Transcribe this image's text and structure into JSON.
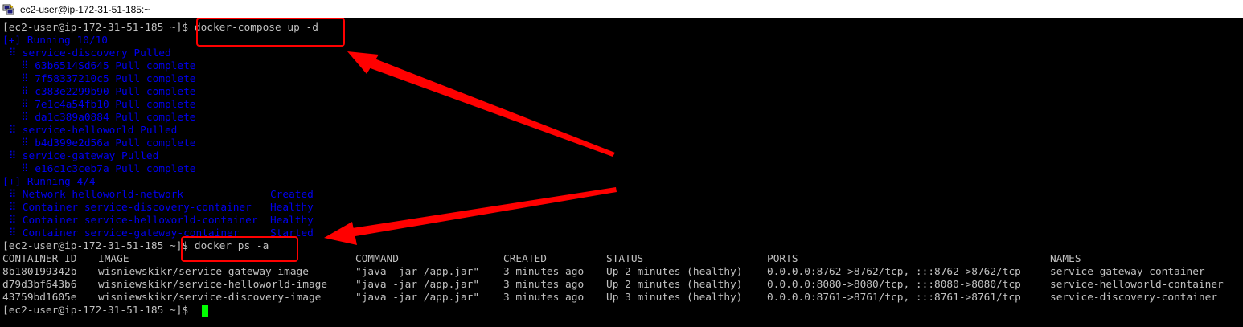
{
  "window": {
    "title": "ec2-user@ip-172-31-51-185:~"
  },
  "colors": {
    "prompt_text": "#c0c0c0",
    "compose_output": "#0000ee",
    "annotation": "#ff0000",
    "cursor": "#00ff00"
  },
  "prompt": "[ec2-user@ip-172-31-51-185 ~]$",
  "commands": {
    "first": "docker-compose up -d",
    "second": "docker ps -a"
  },
  "compose_output": [
    "[+] Running 10/10",
    " ⠿ service-discovery Pulled",
    "   ⠿ 63b6514Sd645 Pull complete",
    "   ⠿ 7f58337210c5 Pull complete",
    "   ⠿ c383e2299b90 Pull complete",
    "   ⠿ 7e1c4a54fb10 Pull complete",
    "   ⠿ da1c389a0884 Pull complete",
    " ⠿ service-helloworld Pulled",
    "   ⠿ b4d399e2d56a Pull complete",
    " ⠿ service-gateway Pulled",
    "   ⠿ e16c1c3ceb7a Pull complete",
    "[+] Running 4/4",
    " ⠿ Network helloworld-network              Created",
    " ⠿ Container service-discovery-container   Healthy",
    " ⠿ Container service-helloworld-container  Healthy",
    " ⠿ Container service-gateway-container     Started"
  ],
  "ps_table": {
    "headers": [
      "CONTAINER ID",
      "IMAGE",
      "COMMAND",
      "CREATED",
      "STATUS",
      "PORTS",
      "NAMES"
    ],
    "rows": [
      [
        "8b180199342b",
        "wisniewskikr/service-gateway-image",
        "\"java -jar /app.jar\"",
        "3 minutes ago",
        "Up 2 minutes (healthy)",
        "0.0.0.0:8762->8762/tcp, :::8762->8762/tcp",
        "service-gateway-container"
      ],
      [
        "d79d3bf643b6",
        "wisniewskikr/service-helloworld-image",
        "\"java -jar /app.jar\"",
        "3 minutes ago",
        "Up 2 minutes (healthy)",
        "0.0.0.0:8080->8080/tcp, :::8080->8080/tcp",
        "service-helloworld-container"
      ],
      [
        "43759bd1605e",
        "wisniewskikr/service-discovery-image",
        "\"java -jar /app.jar\"",
        "3 minutes ago",
        "Up 3 minutes (healthy)",
        "0.0.0.0:8761->8761/tcp, :::8761->8761/tcp",
        "service-discovery-container"
      ]
    ]
  }
}
